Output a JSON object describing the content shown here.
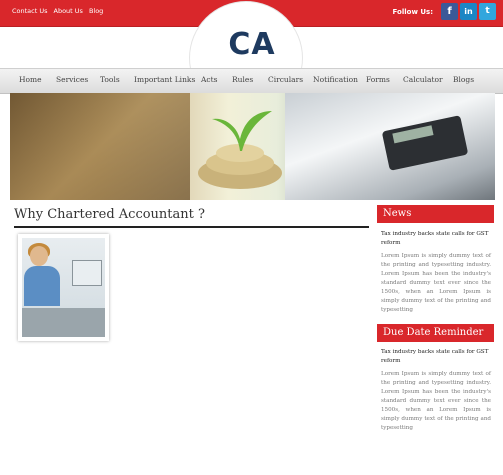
{
  "topbar": {
    "links": [
      "Contact Us",
      "About Us",
      "Blog"
    ],
    "follow_label": "Follow Us:",
    "social": [
      {
        "icon": "facebook-icon",
        "glyph": "f",
        "color": "#3b5998"
      },
      {
        "icon": "linkedin-icon",
        "glyph": "in",
        "color": "#1b86c4"
      },
      {
        "icon": "twitter-icon",
        "glyph": "t",
        "color": "#31a6dd"
      }
    ]
  },
  "logo": {
    "text": "CA"
  },
  "nav": {
    "items": [
      "Home",
      "Services",
      "Tools",
      "Important Links",
      "Acts",
      "Rules",
      "Circulars",
      "Notification",
      "Forms",
      "Calculator",
      "Blogs"
    ]
  },
  "main": {
    "heading": "Why Chartered Accountant ?"
  },
  "sidebar": {
    "sections": [
      {
        "title": "News",
        "item_title": "Tax industry backs state calls for GST reform",
        "item_text": "Lorem Ipsum is simply dummy text of the printing and typesetting industry. Lorem Ipsum has been the industry's standard dummy text ever since the 1500s, when an Lorem Ipsum is simply dummy text of the printing and typesetting"
      },
      {
        "title": "Due Date Reminder",
        "item_title": "Tax industry backs state calls for GST reform",
        "item_text": "Lorem Ipsum is simply dummy text of the printing and typesetting industry. Lorem Ipsum has been the industry's standard dummy text ever since the 1500s, when an Lorem Ipsum is simply dummy text of the printing and typesetting"
      }
    ]
  },
  "colors": {
    "accent": "#d9272b",
    "logo": "#1e3a5f"
  }
}
